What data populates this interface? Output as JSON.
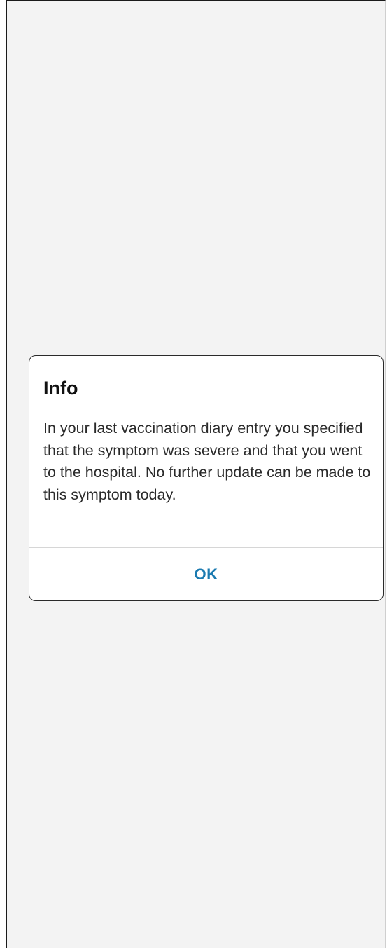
{
  "dialog": {
    "title": "Info",
    "message": "In your last vaccination diary entry you specified that the symptom was severe and that you went to the hospital. No further update can be made to this symptom today.",
    "ok_label": "OK"
  },
  "colors": {
    "background": "#f3f3f3",
    "dialog_background": "#ffffff",
    "accent": "#1a7ab0"
  }
}
